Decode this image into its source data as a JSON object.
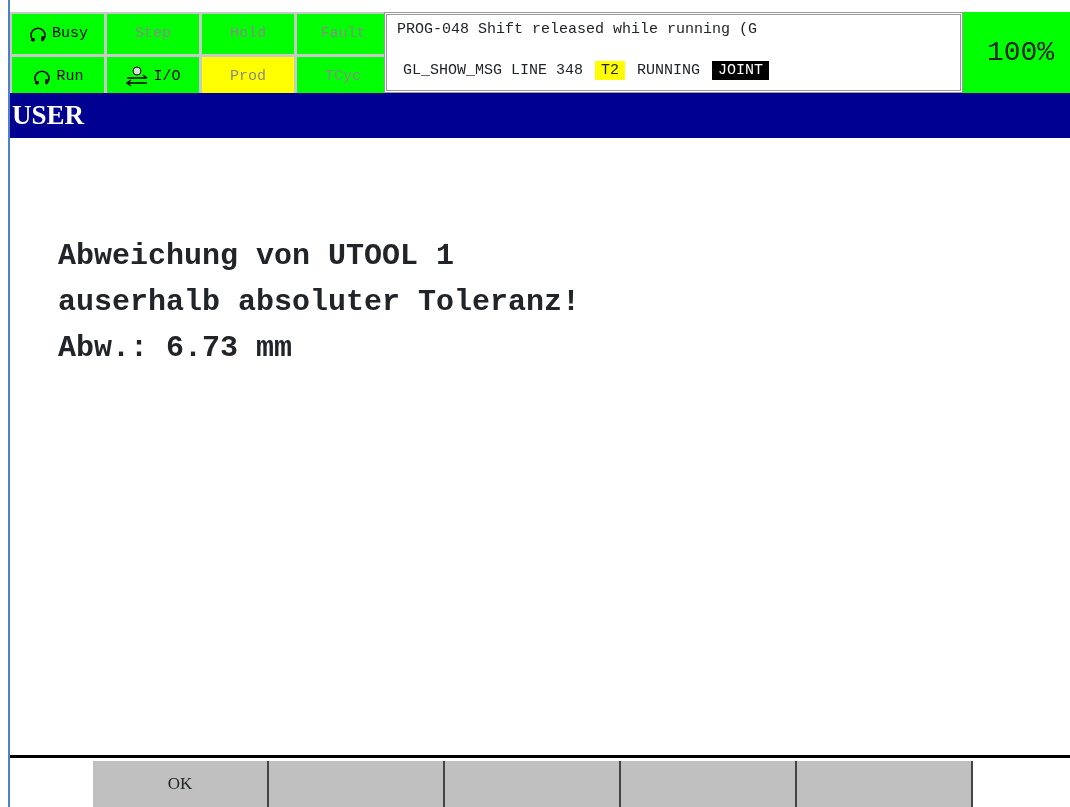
{
  "status_indicators": [
    {
      "label": "Busy",
      "kind": "cycle",
      "active": true,
      "color": "#00ff00"
    },
    {
      "label": "Step",
      "kind": "plain",
      "active": false,
      "color": "#00ff00"
    },
    {
      "label": "Hold",
      "kind": "plain",
      "active": false,
      "color": "#00ff00"
    },
    {
      "label": "Fault",
      "kind": "plain",
      "active": false,
      "color": "#00ff00"
    },
    {
      "label": "Run",
      "kind": "cycle",
      "active": true,
      "color": "#00ff00"
    },
    {
      "label": "I/O",
      "kind": "io",
      "active": true,
      "color": "#00ff00"
    },
    {
      "label": "Prod",
      "kind": "plain",
      "active": false,
      "color": "#ffff00"
    },
    {
      "label": "TCyc",
      "kind": "plain",
      "active": false,
      "color": "#00ff00"
    }
  ],
  "message": {
    "line_1": "PROG-048 Shift released while running (G",
    "line_2": [
      {
        "text": "GL_SHOW_MSG LINE 348",
        "kind": "plain"
      },
      {
        "text": "T2",
        "kind": "warn"
      },
      {
        "text": "RUNNING",
        "kind": "plain"
      },
      {
        "text": "JOINT",
        "kind": "inverse"
      }
    ]
  },
  "override": "100%",
  "screen_title": "USER",
  "content_lines": [
    "Abweichung von UTOOL 1",
    "auserhalb absoluter Toleranz!",
    "Abw.: 6.73 mm"
  ],
  "softkeys": [
    {
      "kind": "labeled",
      "label": "OK"
    },
    {
      "kind": "blank"
    },
    {
      "kind": "blank"
    },
    {
      "kind": "blank"
    },
    {
      "kind": "blank"
    }
  ]
}
